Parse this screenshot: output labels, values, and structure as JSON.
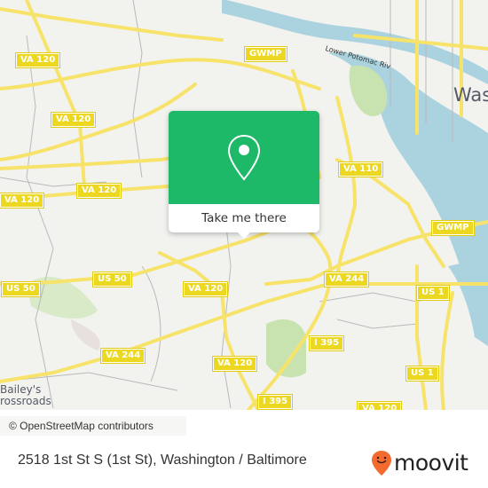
{
  "map": {
    "shields": [
      {
        "id": "va120-a",
        "label": "VA 120"
      },
      {
        "id": "va120-b",
        "label": "VA 120"
      },
      {
        "id": "va120-c",
        "label": "VA 120"
      },
      {
        "id": "va120-d",
        "label": "VA 120"
      },
      {
        "id": "va120-e",
        "label": "VA 120"
      },
      {
        "id": "va120-f",
        "label": "VA 120"
      },
      {
        "id": "va120-g",
        "label": "VA 120"
      },
      {
        "id": "gwmp-a",
        "label": "GWMP"
      },
      {
        "id": "gwmp-b",
        "label": "GWMP"
      },
      {
        "id": "va110",
        "label": "VA 110"
      },
      {
        "id": "va244-a",
        "label": "VA 244"
      },
      {
        "id": "va244-b",
        "label": "VA 244"
      },
      {
        "id": "us50-a",
        "label": "US 50"
      },
      {
        "id": "us50-b",
        "label": "US 50"
      },
      {
        "id": "us1-a",
        "label": "US 1"
      },
      {
        "id": "us1-b",
        "label": "US 1"
      },
      {
        "id": "i395-a",
        "label": "I 395"
      },
      {
        "id": "i395-b",
        "label": "I 395"
      }
    ],
    "places": {
      "washington": "Was",
      "baileys_1": "Bailey's",
      "baileys_2": "rossroads"
    },
    "river_label": "Lower Potomac Riv",
    "attribution": "© OpenStreetMap contributors"
  },
  "popup": {
    "icon": "map-pin-icon",
    "cta_label": "Take me there"
  },
  "footer": {
    "address": "2518 1st St S (1st St), Washington / Baltimore",
    "brand": "moovit",
    "brand_color": "#f26a2e",
    "accent_green": "#1eb968"
  }
}
